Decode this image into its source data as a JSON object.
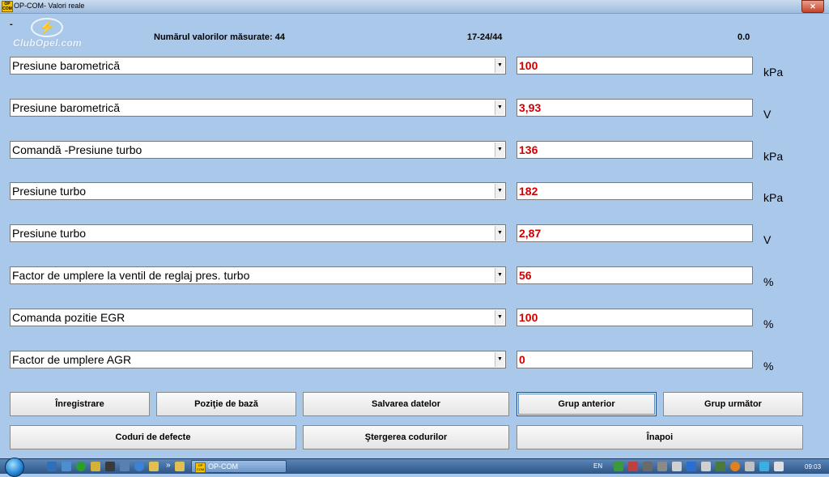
{
  "window": {
    "title": "OP-COM- Valori reale",
    "app_icon_text": "OP COM",
    "close_label": "✕"
  },
  "logo": {
    "dash": "-",
    "text": "ClubOpel.com"
  },
  "header": {
    "count_label": "Numărul valorilor măsurate: 44",
    "range": "17-24/44",
    "time": "0.0"
  },
  "rows": [
    {
      "param": "Presiune barometrică",
      "value": "100",
      "unit": "kPa"
    },
    {
      "param": "Presiune barometrică",
      "value": "3,93",
      "unit": "V"
    },
    {
      "param": "Comandă -Presiune turbo",
      "value": "136",
      "unit": "kPa"
    },
    {
      "param": "Presiune turbo",
      "value": "182",
      "unit": "kPa"
    },
    {
      "param": "Presiune turbo",
      "value": "2,87",
      "unit": "V"
    },
    {
      "param": "Factor de umplere la ventil  de reglaj pres. turbo",
      "value": "56",
      "unit": "%"
    },
    {
      "param": "Comanda pozitie EGR",
      "value": "100",
      "unit": "%"
    },
    {
      "param": "Factor de umplere AGR",
      "value": "0",
      "unit": "%"
    }
  ],
  "buttons": {
    "record": "Înregistrare",
    "base_position": "Poziţie de bază",
    "save_data": "Salvarea datelor",
    "prev_group": "Grup anterior",
    "next_group": "Grup următor",
    "fault_codes": "Coduri de defecte",
    "clear_codes": "Ştergerea codurilor",
    "back": "Înapoi"
  },
  "taskbar": {
    "task_label": "OP-COM",
    "task_icon_text": "OP COM",
    "language": "EN",
    "clock": "09:03"
  }
}
